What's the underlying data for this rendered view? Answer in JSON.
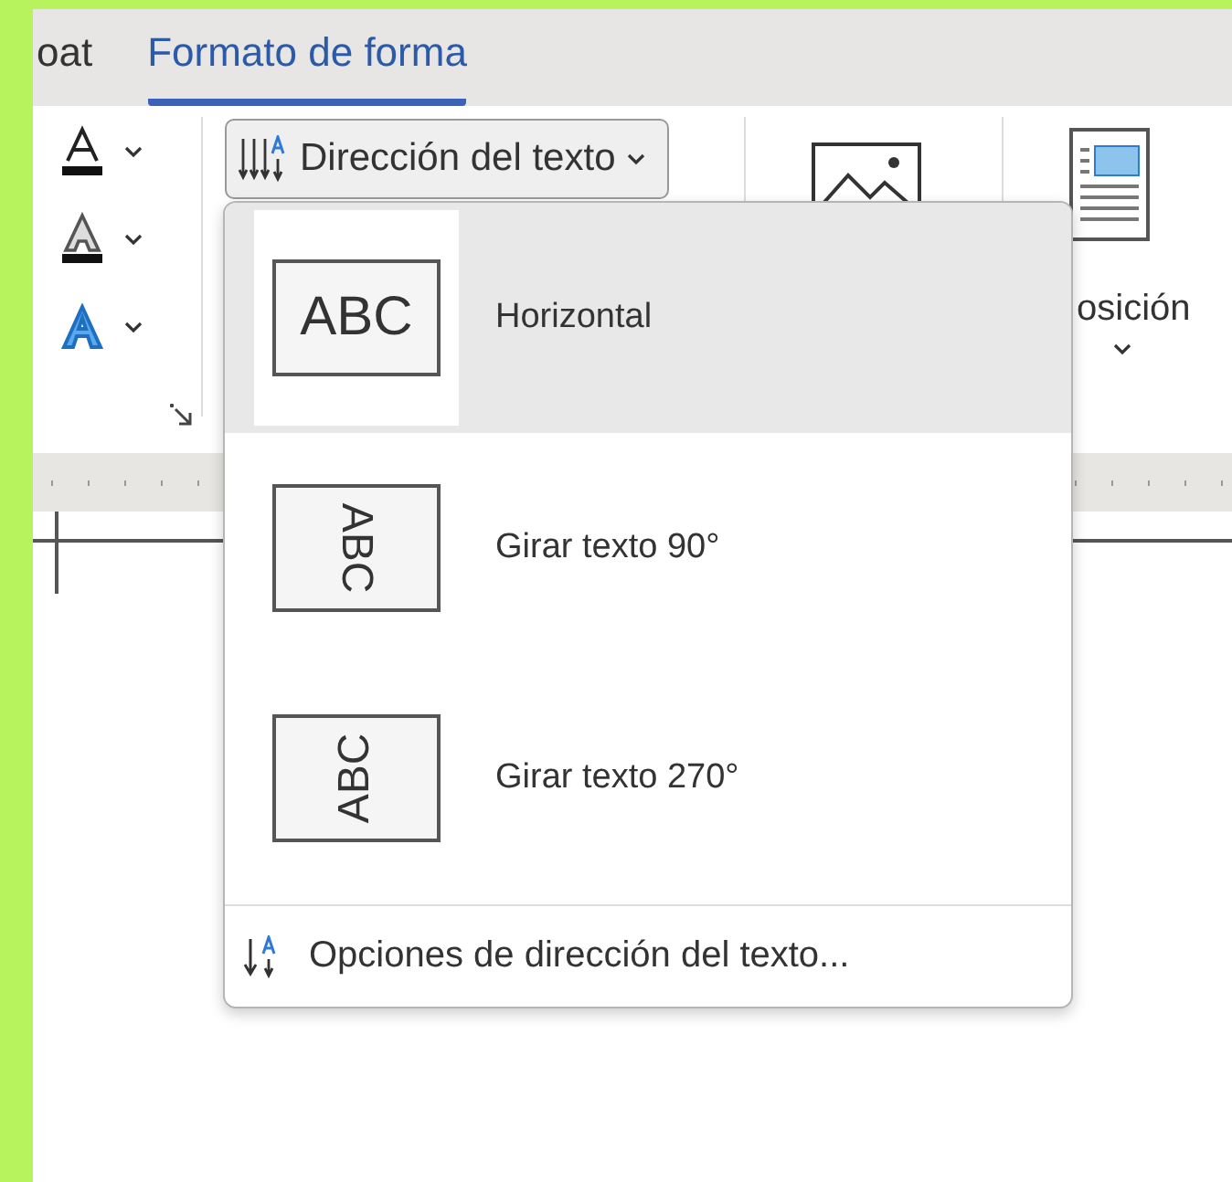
{
  "tabs": [
    {
      "label": "oat",
      "selected": false
    },
    {
      "label": "Formato de forma",
      "selected": true
    }
  ],
  "ribbon": {
    "text_direction_button": {
      "label": "Dirección del texto",
      "expanded": true
    },
    "position_button": {
      "label": "osición"
    }
  },
  "menu": {
    "items": [
      {
        "kind": "horizontal",
        "preview_text": "ABC",
        "label": "Horizontal",
        "selected": true
      },
      {
        "kind": "rotate90",
        "preview_text": "ABC",
        "label": "Girar texto 90°",
        "selected": false
      },
      {
        "kind": "rotate270",
        "preview_text": "ABC",
        "label": "Girar texto 270°",
        "selected": false
      }
    ],
    "footer": {
      "label": "Opciones de dirección del texto..."
    }
  }
}
